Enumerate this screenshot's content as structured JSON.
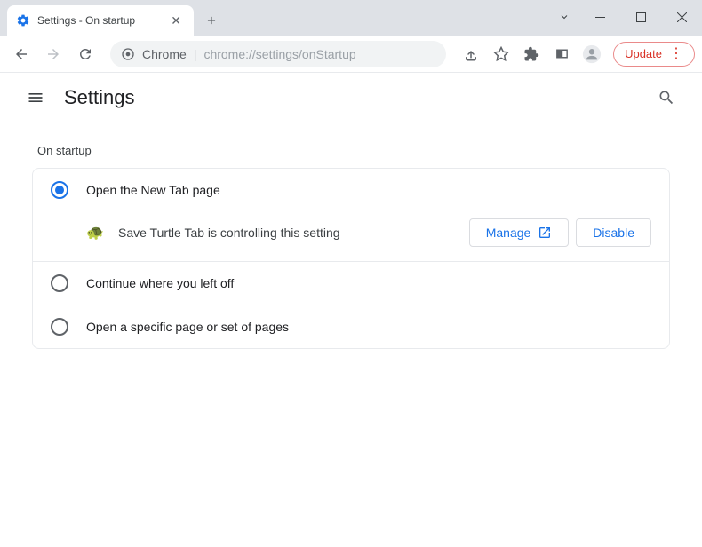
{
  "tab": {
    "title": "Settings - On startup"
  },
  "omnibox": {
    "host": "Chrome",
    "path": "chrome://settings/onStartup"
  },
  "updateButton": {
    "label": "Update"
  },
  "header": {
    "title": "Settings"
  },
  "section": {
    "title": "On startup"
  },
  "options": {
    "newTab": {
      "label": "Open the New Tab page",
      "selected": true
    },
    "continue": {
      "label": "Continue where you left off",
      "selected": false
    },
    "specific": {
      "label": "Open a specific page or set of pages",
      "selected": false
    }
  },
  "controlledBy": {
    "icon": "🐢",
    "text": "Save Turtle Tab is controlling this setting",
    "manageLabel": "Manage",
    "disableLabel": "Disable"
  }
}
